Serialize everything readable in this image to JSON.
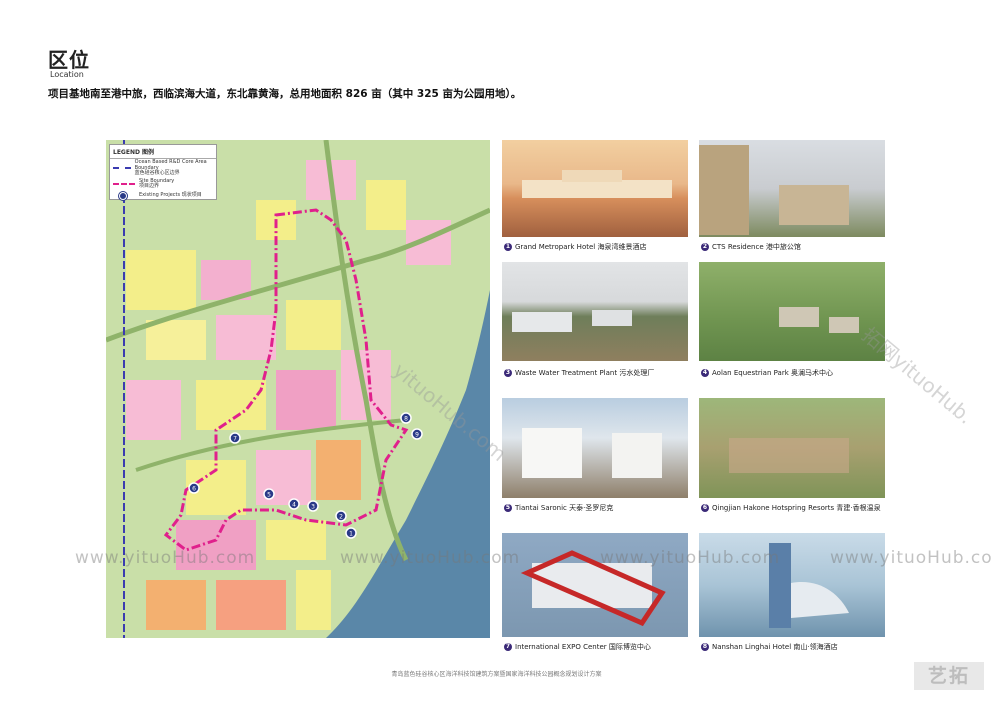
{
  "header": {
    "title": "区位",
    "subtitle": "Location",
    "description": "项目基地南至港中旅，西临滨海大道，东北靠黄海，总用地面积 826 亩（其中 325 亩为公园用地）。"
  },
  "legend": {
    "title": "LEGEND 图例",
    "items": [
      {
        "label_en": "Ocean Based R&D Core Area Boundary",
        "label_cn": "蓝色硅谷核心区边界",
        "color": "#3b3bb0"
      },
      {
        "label_en": "Site Boundary",
        "label_cn": "项目边界",
        "color": "#e0208c"
      },
      {
        "label_en": "Existing Projects",
        "label_cn": "现状项目",
        "color": "#2a3a88"
      }
    ]
  },
  "map": {
    "markers": [
      "1",
      "2",
      "3",
      "4",
      "5",
      "6",
      "7",
      "8",
      "9"
    ],
    "colors": {
      "site_boundary": "#e0208c",
      "core_boundary": "#3b3bb0",
      "sea": "#5a87a8",
      "green": "#c9dfa8"
    }
  },
  "projects": [
    {
      "num": "1",
      "name_en": "Grand Metropark Hotel",
      "name_cn": "海泉湾维景酒店"
    },
    {
      "num": "2",
      "name_en": "CTS Residence",
      "name_cn": "港中旅公馆"
    },
    {
      "num": "3",
      "name_en": "Waste Water Treatment Plant",
      "name_cn": "污水处理厂"
    },
    {
      "num": "4",
      "name_en": "Aolan Equestrian Park",
      "name_cn": "奥澜马术中心"
    },
    {
      "num": "5",
      "name_en": "Tiantai Saronic",
      "name_cn": "天泰·圣罗尼克"
    },
    {
      "num": "6",
      "name_en": "Qingjian Hakone Hotspring Resorts",
      "name_cn": "青建·香根温泉"
    },
    {
      "num": "7",
      "name_en": "International EXPO Center",
      "name_cn": "国际博览中心"
    },
    {
      "num": "8",
      "name_en": "Nanshan Linghai Hotel",
      "name_cn": "南山·领海酒店"
    }
  ],
  "watermarks": [
    "www.yituoHub.com",
    "www.yituoHub.com",
    "www.yituoHub.com",
    "www.yituoHub.com",
    "拓网yituoHub.",
    "yituoHub.com"
  ],
  "footer": {
    "text": "青岛蓝色硅谷核心区海洋科技馆建筑方案暨国家海洋科技公园概念规划设计方案",
    "logo": "艺拓"
  }
}
